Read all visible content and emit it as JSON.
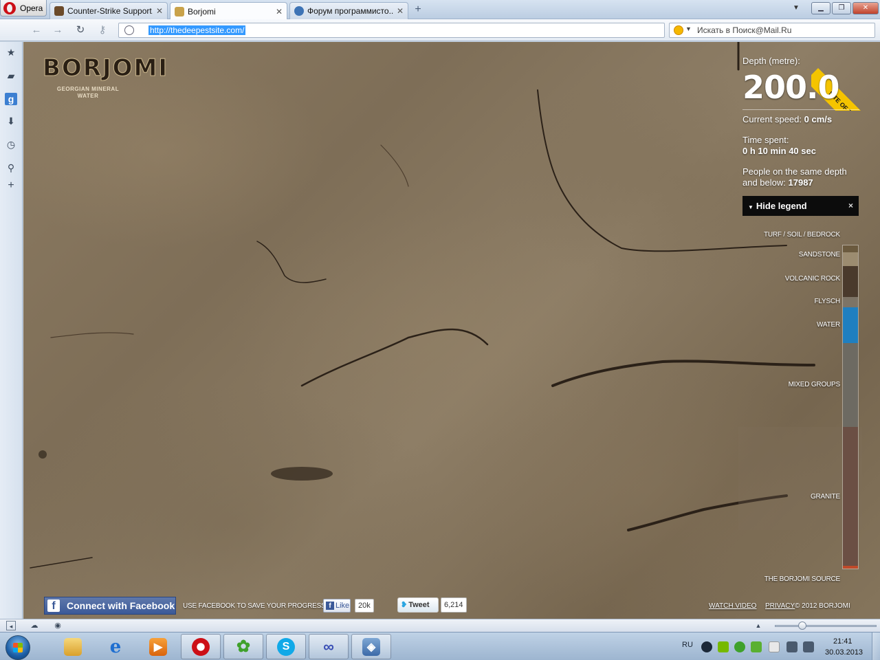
{
  "browser": {
    "menu_label": "Opera",
    "tabs": [
      {
        "label": "Counter-Strike Support..."
      },
      {
        "label": "Borjomi"
      },
      {
        "label": "Форум программисто..."
      }
    ],
    "url": "http://thedeepestsite.com/",
    "search_placeholder": "Искать в Поиск@Mail.Ru"
  },
  "site": {
    "logo": "BORJOMI",
    "tagline": "GEORGIAN MINERAL WATER",
    "award": "SITE OF THE DAY",
    "depth_label": "Depth (metre):",
    "depth_value": "200.0",
    "speed_label": "Current speed:",
    "speed_value": "0 cm/s",
    "time_label": "Time spent:",
    "time_value": "0 h 10 min 40 sec",
    "people_label": "People on the same depth and below:",
    "people_value": "17987",
    "legend_toggle": "Hide legend",
    "legend_close": "×",
    "layers": [
      {
        "label": "TURF / SOIL / BEDROCK",
        "color": "#6b5a3e"
      },
      {
        "label": "SANDSTONE",
        "color": "#9c8c70"
      },
      {
        "label": "VOLCANIC ROCK",
        "color": "#4a3a2c"
      },
      {
        "label": "FLYSCH",
        "color": "#7d7466"
      },
      {
        "label": "WATER",
        "color": "#1f7fc0"
      },
      {
        "label": "MIXED GROUPS",
        "color": "#6d6a62"
      },
      {
        "label": "GRANITE",
        "color": "#6b4f44"
      },
      {
        "label": "THE BORJOMI SOURCE",
        "color": "#c04a2a"
      }
    ],
    "facebook_connect": "Connect with Facebook",
    "facebook_save_text": "USE FACEBOOK TO SAVE YOUR PROGRESS",
    "like_label": "Like",
    "like_count": "20k",
    "tweet_label": "Tweet",
    "tweet_count": "6,214",
    "watch_video": "WATCH VIDEO",
    "privacy": "PRIVACY",
    "copyright": "© 2012 BORJOMI"
  },
  "taskbar": {
    "language": "RU",
    "time": "21:41",
    "date": "30.03.2013"
  }
}
